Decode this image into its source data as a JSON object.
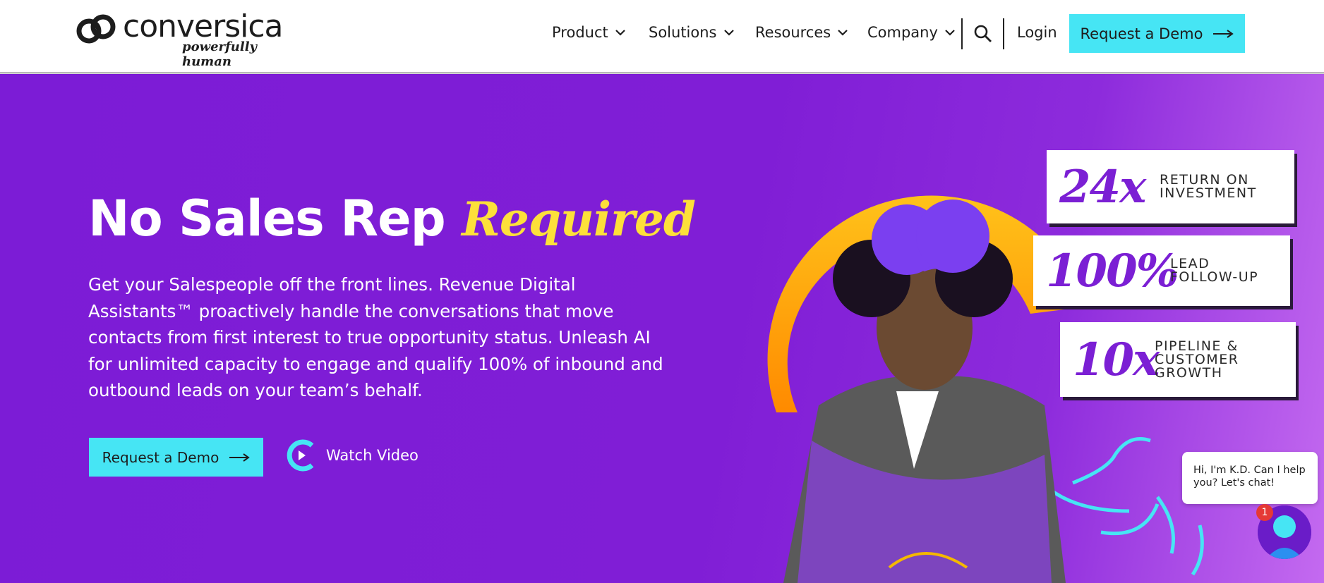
{
  "brand": {
    "name": "conversica",
    "tagline": "powerfully human"
  },
  "nav": {
    "items": [
      {
        "label": "Product"
      },
      {
        "label": "Solutions"
      },
      {
        "label": "Resources"
      },
      {
        "label": "Company"
      }
    ],
    "login_label": "Login",
    "demo_label": "Request a Demo"
  },
  "hero": {
    "title_main": "No Sales Rep ",
    "title_accent": "Required",
    "body": "Get your Salespeople off the front lines. Revenue Digital Assistants™ proactively handle the conversations that move contacts from first interest to true opportunity status. Unleash AI for unlimited capacity to engage and qualify 100% of inbound and outbound leads on your team’s behalf.",
    "demo_label": "Request a Demo",
    "watch_label": "Watch Video"
  },
  "stats": [
    {
      "number": "24x",
      "label": "Return on Investment"
    },
    {
      "number": "100%",
      "label": "Lead Follow-up"
    },
    {
      "number": "10x",
      "label": "Pipeline & Customer Growth"
    }
  ],
  "chat": {
    "message": "Hi, I'm K.D. Can I help you? Let's chat!",
    "badge_count": "1"
  },
  "colors": {
    "accent_cyan": "#46e5f4",
    "hero_purple": "#7c1cd6",
    "accent_yellow": "#fde03a"
  }
}
